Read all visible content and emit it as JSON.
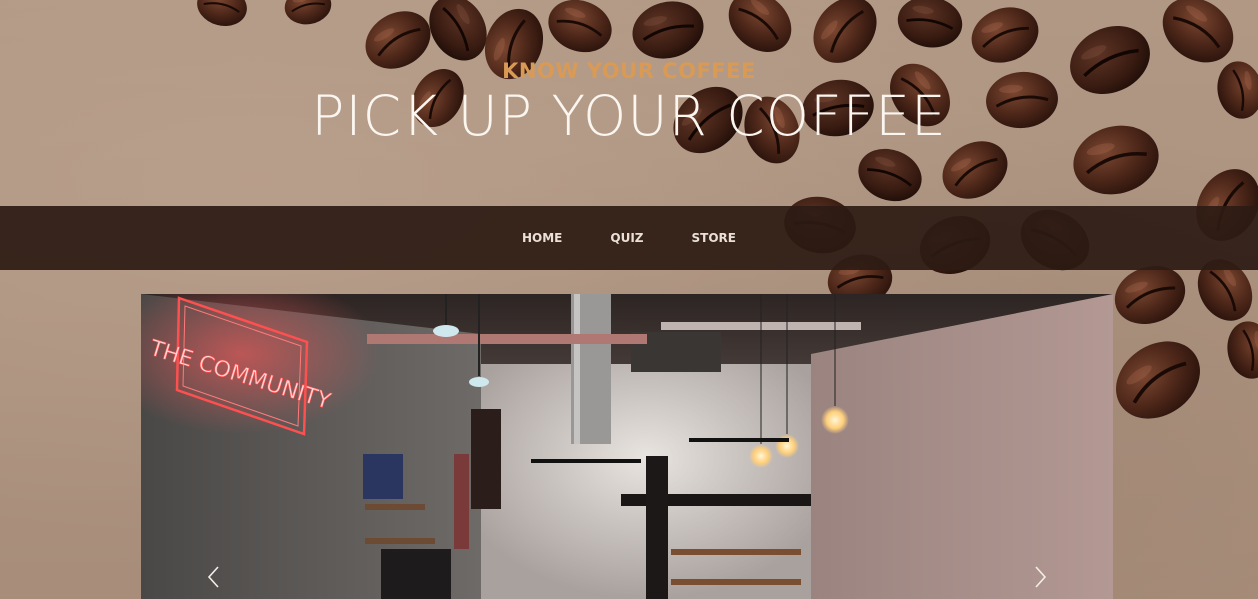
{
  "hero": {
    "kicker": "KNOW YOUR COFFEE",
    "headline": "PICK UP YOUR COFFEE"
  },
  "nav": {
    "items": [
      {
        "label": "HOME"
      },
      {
        "label": "QUIZ"
      },
      {
        "label": "STORE"
      }
    ]
  },
  "slideshow": {
    "neon_sign": "THE COMMUNITY",
    "prev_icon": "chevron-left-icon",
    "next_icon": "chevron-right-icon"
  },
  "colors": {
    "kicker": "#d99a56",
    "headline": "#fbf6f0",
    "navbar": "#2d1b14",
    "nav_text": "#eae0d6",
    "neon": "#ff4d4d"
  }
}
